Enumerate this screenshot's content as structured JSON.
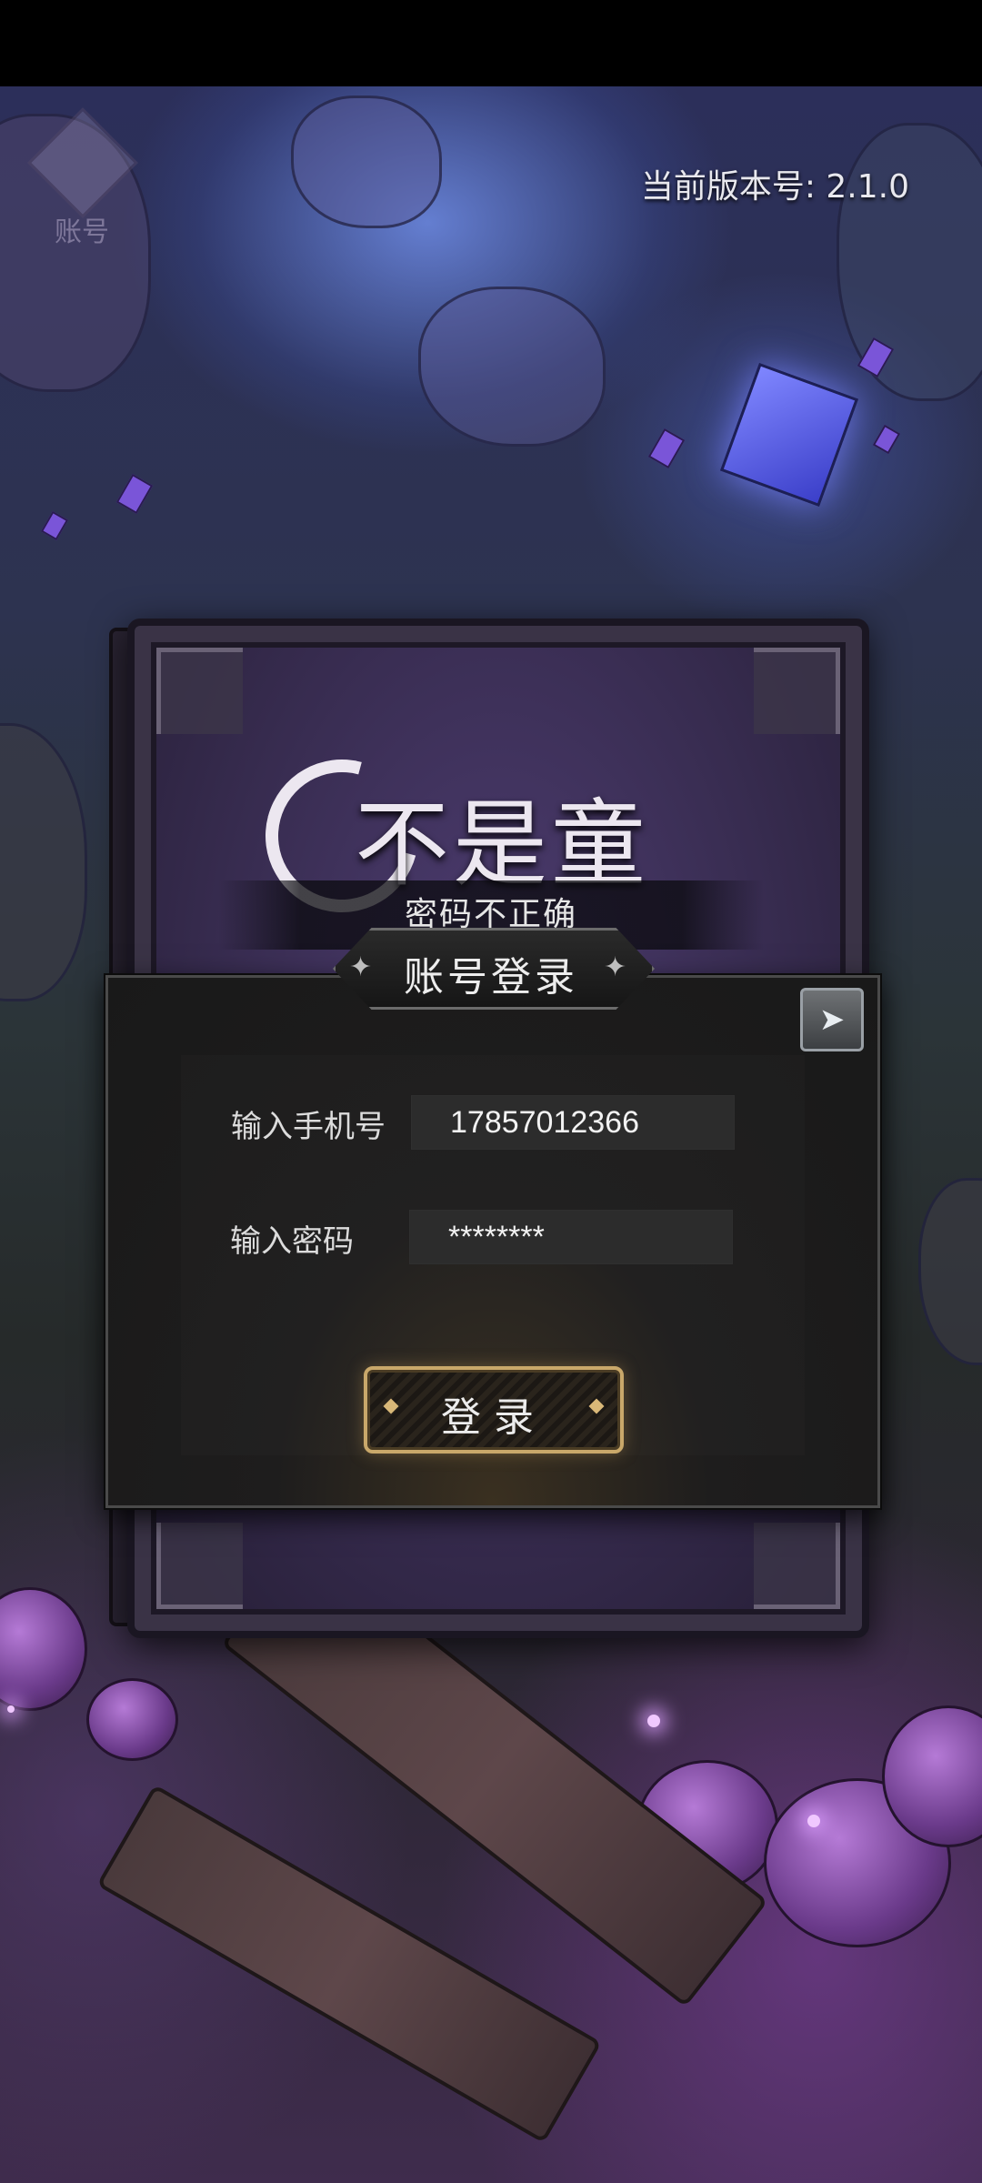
{
  "header": {
    "account_label": "账号",
    "version_text": "当前版本号:  2.1.0"
  },
  "logo": {
    "title": "不是童话"
  },
  "error": {
    "message": "密码不正确"
  },
  "login_panel": {
    "title": "账号登录",
    "phone_label": "输入手机号",
    "phone_value": "17857012366",
    "password_label": "输入密码",
    "password_value": "********",
    "login_button_label": "登录"
  },
  "colors": {
    "panel_bg": "#1e1d1d",
    "button_border": "#c9a86a",
    "input_bg": "#2c2c2c",
    "text_light": "#ededed"
  },
  "icons": {
    "account": "hooded-figure-icon",
    "close": "back-arrow-icon"
  }
}
